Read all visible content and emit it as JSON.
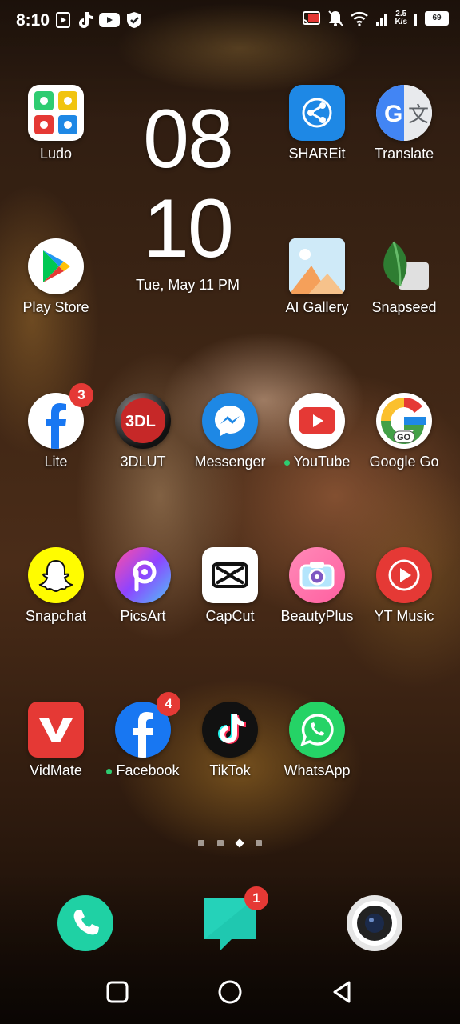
{
  "status_bar": {
    "time": "8:10",
    "left_icons": [
      "media-icon",
      "tiktok-icon",
      "youtube-icon",
      "shield-icon"
    ],
    "network_speed_top": "2.5",
    "network_speed_bottom": "K/s",
    "battery": "69",
    "right_icons": [
      "cast-icon",
      "mute-icon",
      "wifi-icon",
      "signal-icon",
      "battery-icon"
    ]
  },
  "clock_widget": {
    "hour": "08",
    "minute": "10",
    "date": "Tue, May 11 PM"
  },
  "apps": [
    {
      "name": "Ludo",
      "icon": "ludo-icon"
    },
    {
      "name": "SHAREit",
      "icon": "shareit-icon"
    },
    {
      "name": "Translate",
      "icon": "translate-icon"
    },
    {
      "name": "Play Store",
      "icon": "play-store-icon"
    },
    {
      "name": "AI Gallery",
      "icon": "gallery-icon"
    },
    {
      "name": "Snapseed",
      "icon": "snapseed-icon"
    },
    {
      "name": "Lite",
      "icon": "facebook-lite-icon",
      "badge": "3"
    },
    {
      "name": "3DLUT",
      "icon": "3dlut-icon"
    },
    {
      "name": "Messenger",
      "icon": "messenger-icon"
    },
    {
      "name": "YouTube",
      "icon": "youtube-icon"
    },
    {
      "name": "Google Go",
      "icon": "google-go-icon"
    },
    {
      "name": "Snapchat",
      "icon": "snapchat-icon"
    },
    {
      "name": "PicsArt",
      "icon": "picsart-icon"
    },
    {
      "name": "CapCut",
      "icon": "capcut-icon"
    },
    {
      "name": "BeautyPlus",
      "icon": "beautyplus-icon"
    },
    {
      "name": "YT Music",
      "icon": "yt-music-icon"
    },
    {
      "name": "VidMate",
      "icon": "vidmate-icon"
    },
    {
      "name": "Facebook",
      "icon": "facebook-icon",
      "badge": "4"
    },
    {
      "name": "TikTok",
      "icon": "tiktok-icon"
    },
    {
      "name": "WhatsApp",
      "icon": "whatsapp-icon"
    }
  ],
  "page_indicator": {
    "pages": 4,
    "current_page": 3
  },
  "dock": [
    {
      "icon": "phone-icon"
    },
    {
      "icon": "messages-icon",
      "badge": "1"
    },
    {
      "icon": "camera-icon"
    }
  ],
  "nav_bar": [
    "recents-button",
    "home-button",
    "back-button"
  ],
  "colors": {
    "badge": "#e53935",
    "new_app_dot": "#2ecc71",
    "text": "#ffffff"
  }
}
